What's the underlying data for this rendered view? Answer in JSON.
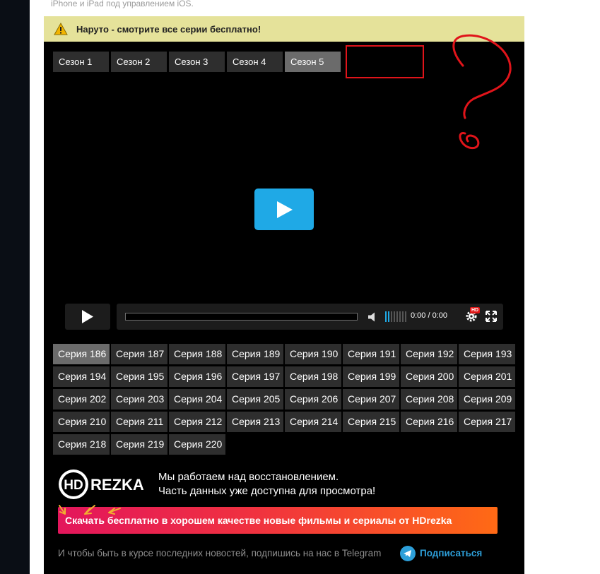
{
  "page": {
    "top_text": "iPhone и iPad под управлением iOS."
  },
  "notice": {
    "icon": "warning-icon",
    "text": "Наруто - смотрите все серии бесплатно!"
  },
  "seasons": [
    {
      "label": "Сезон 1",
      "active": false
    },
    {
      "label": "Сезон 2",
      "active": false
    },
    {
      "label": "Сезон 3",
      "active": false
    },
    {
      "label": "Сезон 4",
      "active": false
    },
    {
      "label": "Сезон 5",
      "active": true
    }
  ],
  "player": {
    "time": "0:00 / 0:00",
    "hd_badge": "HD",
    "progress": 0,
    "volume_level": 0.2,
    "colors": {
      "accent": "#1fa9e6",
      "background": "#000000"
    }
  },
  "episodes": [
    {
      "label": "Серия 186",
      "active": true
    },
    {
      "label": "Серия 187"
    },
    {
      "label": "Серия 188"
    },
    {
      "label": "Серия 189"
    },
    {
      "label": "Серия 190"
    },
    {
      "label": "Серия 191"
    },
    {
      "label": "Серия 192"
    },
    {
      "label": "Серия 193"
    },
    {
      "label": "Серия 194"
    },
    {
      "label": "Серия 195"
    },
    {
      "label": "Серия 196"
    },
    {
      "label": "Серия 197"
    },
    {
      "label": "Серия 198"
    },
    {
      "label": "Серия 199"
    },
    {
      "label": "Серия 200"
    },
    {
      "label": "Серия 201"
    },
    {
      "label": "Серия 202"
    },
    {
      "label": "Серия 203"
    },
    {
      "label": "Серия 204"
    },
    {
      "label": "Серия 205"
    },
    {
      "label": "Серия 206"
    },
    {
      "label": "Серия 207"
    },
    {
      "label": "Серия 208"
    },
    {
      "label": "Серия 209"
    },
    {
      "label": "Серия 210"
    },
    {
      "label": "Серия 211"
    },
    {
      "label": "Серия 212"
    },
    {
      "label": "Серия 213"
    },
    {
      "label": "Серия 214"
    },
    {
      "label": "Серия 215"
    },
    {
      "label": "Серия 216"
    },
    {
      "label": "Серия 217"
    },
    {
      "label": "Серия 218"
    },
    {
      "label": "Серия 219"
    },
    {
      "label": "Серия 220"
    }
  ],
  "promo": {
    "logo_hd": "HD",
    "logo_text": "REZKA",
    "message_line1": "Мы работаем над восстановлением.",
    "message_line2": "Часть данных уже доступна для просмотра!",
    "download_button": "Скачать бесплатно в хорошем качестве новые фильмы и сериалы от HDrezka",
    "telegram_text": "И чтобы быть в курсе последних новостей, подпишись на нас в Telegram",
    "subscribe_link": "Подписаться"
  }
}
